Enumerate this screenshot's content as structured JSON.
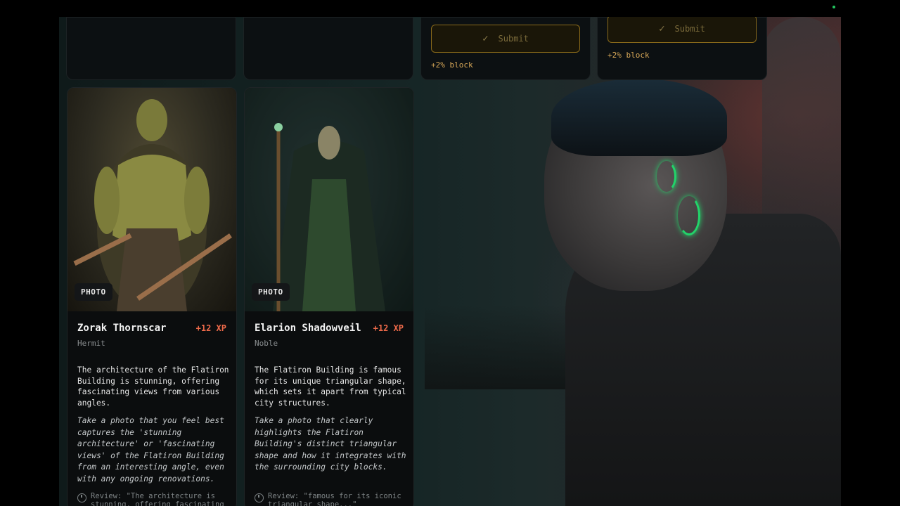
{
  "top_cards": [
    {
      "submit_label": "Submit",
      "bonus": "+2% block"
    },
    {
      "submit_label": "Submit",
      "bonus": "+2% block"
    }
  ],
  "cards": [
    {
      "badge": "PHOTO",
      "name": "Zorak Thornscar",
      "xp": "+12 XP",
      "role": "Hermit",
      "description": "The architecture of the Flatiron Building is stunning, offering fascinating views from various angles.",
      "task": "Take a photo that you feel best captures the 'stunning architecture' or 'fascinating views' of the Flatiron Building from an interesting angle, even with any ongoing renovations.",
      "review": "Review: \"The architecture is stunning, offering fascinating"
    },
    {
      "badge": "PHOTO",
      "name": "Elarion Shadowveil",
      "xp": "+12 XP",
      "role": "Noble",
      "description": "The Flatiron Building is famous for its unique triangular shape, which sets it apart from typical city structures.",
      "task": "Take a photo that clearly highlights the Flatiron Building's distinct triangular shape and how it integrates with the surrounding city blocks.",
      "review": "Review: \"famous for its iconic triangular shape...\""
    }
  ],
  "colors": {
    "accent_gold": "#d8a858",
    "xp_red": "#ee6a4a",
    "status_green": "#22c55e"
  }
}
